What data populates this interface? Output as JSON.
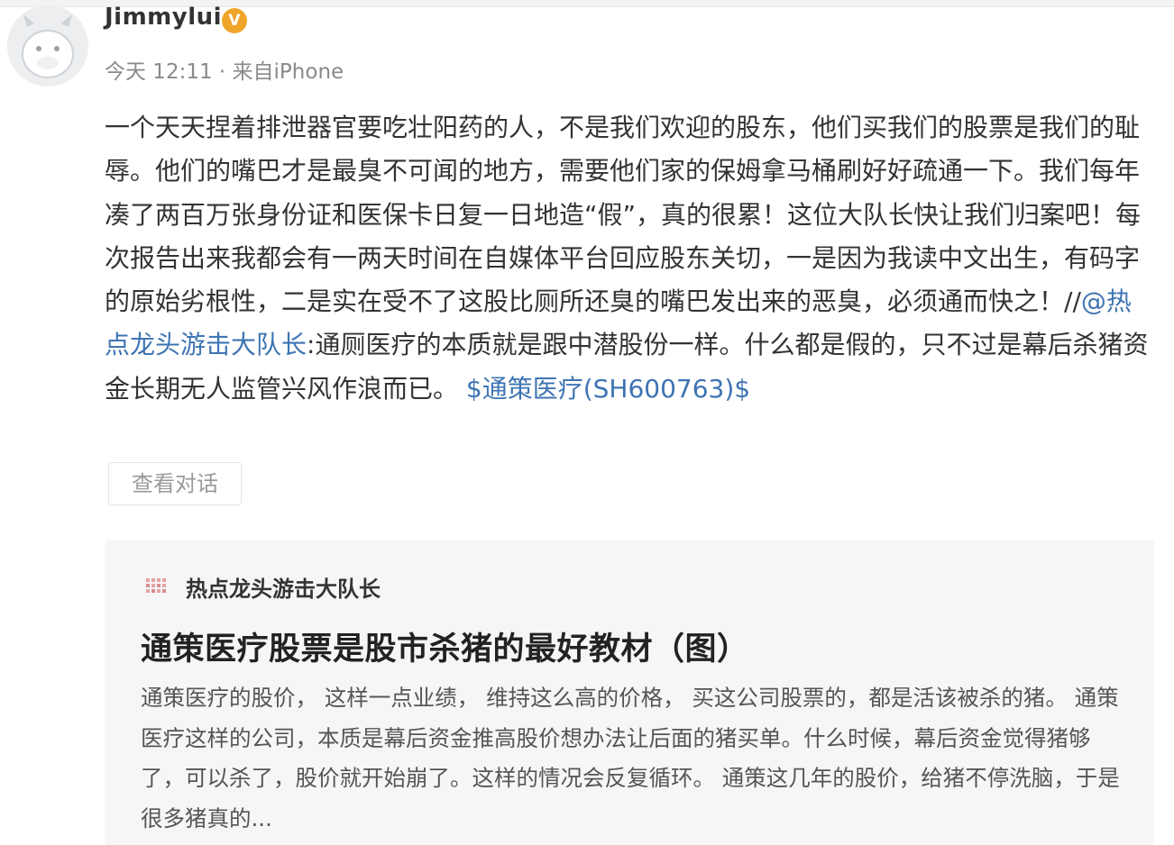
{
  "post": {
    "author_name": "Jimmylui",
    "verified_badge_icon": "verified-v-badge-icon",
    "time": "今天 12:11",
    "separator": " · ",
    "source": "来自iPhone",
    "text_part1": "一个天天捏着排泄器官要吃壮阳药的人，不是我们欢迎的股东，他们买我们的股票是我们的耻辱。他们的嘴巴才是最臭不可闻的地方，需要他们家的保姆拿马桶刷好好疏通一下。我们每年凑了两百万张身份证和医保卡日复一日地造“假”，真的很累！这位大队长快让我们归案吧！每次报告出来我都会有一两天时间在自媒体平台回应股东关切，一是因为我读中文出生，有码字的原始劣根性，二是实在受不了这股比厕所还臭的嘴巴发出来的恶臭，必须通而快之！",
    "repost_prefix": "//",
    "mention": "@热点龙头游击大队长",
    "text_part2": ":通厕医疗的本质就是跟中潜股份一样。什么都是假的，只不过是幕后杀猪资金长期无人监管兴风作浪而已。 ",
    "stock_tag": "$通策医疗(SH600763)$",
    "view_conversation_label": "查看对话"
  },
  "quoted_post": {
    "author_icon": "author-avatar-icon",
    "author_name": "热点龙头游击大队长",
    "title": "通策医疗股票是股市杀猪的最好教材（图）",
    "body": "通策医疗的股价， 这样一点业绩， 维持这么高的价格， 买这公司股票的，都是活该被杀的猪。 通策医疗这样的公司，本质是幕后资金推高股价想办法让后面的猪买单。什么时候，幕后资金觉得猪够了，可以杀了，股价就开始崩了。这样的情况会反复循环。 通策这几年的股价，给猪不停洗脑，于是很多猪真的..."
  },
  "colors": {
    "link": "#3e74b3",
    "verified_badge": "#f0a52a",
    "card_background": "#f6f6f6",
    "meta_text": "#8a8a8a"
  }
}
